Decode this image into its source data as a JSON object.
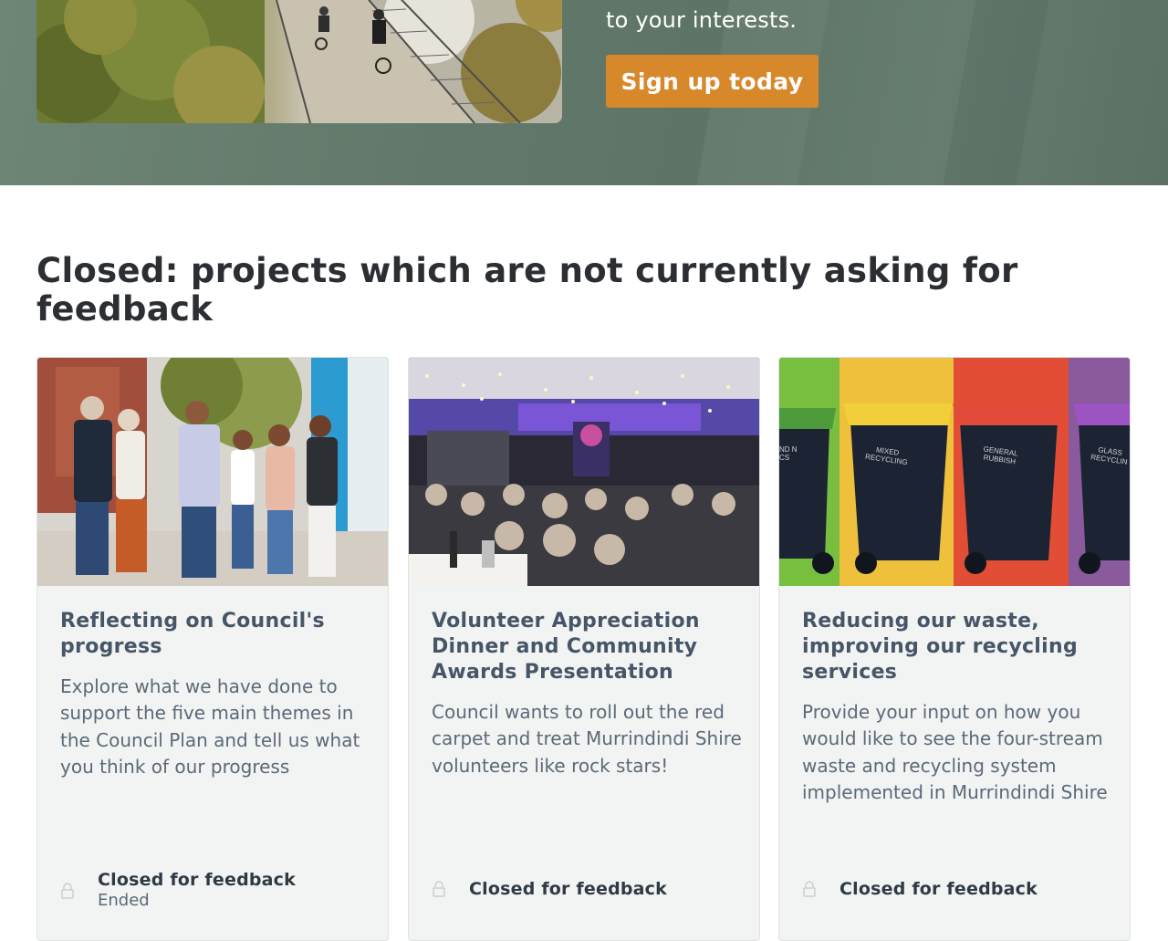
{
  "hero": {
    "intro_fragment": "to your interests.",
    "signup_label": "Sign up today"
  },
  "closed_section": {
    "heading": "Closed: projects which are not currently asking for feedback",
    "cards": [
      {
        "title": "Reflecting on Council's progress",
        "description": "Explore what we have done to support the five main themes in the Council Plan and tell us what you think of our progress",
        "status": "Closed for feedback",
        "status_sub": "Ended",
        "image_icon": "family-walking-photo",
        "lock_icon": "lock-icon"
      },
      {
        "title": "Volunteer Appreciation Dinner and Community Awards Presentation",
        "description": "Council wants to roll out the red carpet and treat Murrindindi Shire volunteers like rock stars!",
        "status": "Closed for feedback",
        "image_icon": "dinner-event-photo",
        "lock_icon": "lock-icon"
      },
      {
        "title": "Reducing our waste, improving our recycling services",
        "description": "Provide your input on how you would like to see the four-stream waste and recycling system implemented in Murrindindi Shire",
        "status": "Closed for feedback",
        "image_icon": "recycling-bins-photo",
        "lock_icon": "lock-icon",
        "bin_labels": [
          "ND N CS",
          "MIXED RECYCLING",
          "GENERAL RUBBISH",
          "GLASS RECYCLIN"
        ]
      }
    ]
  },
  "colors": {
    "hero_bg": "#637a6c",
    "signup_bg": "#d7882b",
    "card_bg": "#f2f4f3",
    "card_title": "#475667",
    "heading": "#2b2f33"
  }
}
